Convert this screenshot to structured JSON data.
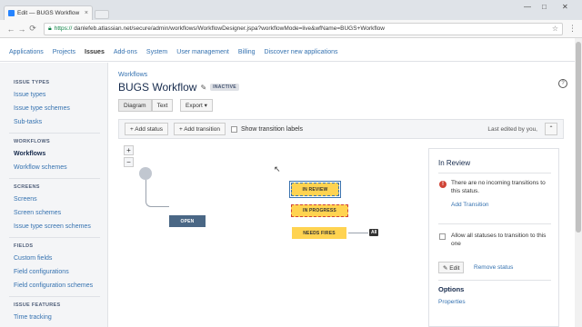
{
  "browser": {
    "tab_title": "Edit — BUGS Workflow",
    "tab_close": "×",
    "win_min": "—",
    "win_max": "□",
    "win_close": "✕",
    "secure_label": "https://",
    "url_rest": "danlefeb.atlassian.net/secure/admin/workflows/WorkflowDesigner.jspa?workflowMode=live&wfName=BUGS+Workflow",
    "back_icon": "←",
    "forward_icon": "→",
    "reload_icon": "⟳",
    "star_icon": "☆",
    "menu_icon": "⋮"
  },
  "admin_nav": [
    "Applications",
    "Projects",
    "Issues",
    "Add-ons",
    "System",
    "User management",
    "Billing",
    "Discover new applications"
  ],
  "admin_nav_active": "Issues",
  "sidebar": {
    "issue_types": {
      "heading": "ISSUE TYPES",
      "items": [
        "Issue types",
        "Issue type schemes",
        "Sub-tasks"
      ]
    },
    "workflows": {
      "heading": "WORKFLOWS",
      "items": [
        "Workflows",
        "Workflow schemes"
      ]
    },
    "screens": {
      "heading": "SCREENS",
      "items": [
        "Screens",
        "Screen schemes",
        "Issue type screen schemes"
      ]
    },
    "fields": {
      "heading": "FIELDS",
      "items": [
        "Custom fields",
        "Field configurations",
        "Field configuration schemes"
      ]
    },
    "issue_features": {
      "heading": "ISSUE FEATURES",
      "items": [
        "Time tracking"
      ]
    }
  },
  "main": {
    "breadcrumb": "Workflows",
    "title": "BUGS Workflow",
    "status_lozenge": "INACTIVE",
    "help_icon": "?",
    "view_buttons": [
      "Diagram",
      "Text"
    ],
    "export_label": "Export ▾",
    "add_status": "+ Add status",
    "add_transition": "+ Add transition",
    "show_labels": "Show transition labels",
    "last_edited": "Last edited by you,",
    "collapse_icon": "⌃"
  },
  "diagram": {
    "zoom_in": "+",
    "zoom_out": "−",
    "nodes": [
      {
        "label": "IN REVIEW",
        "color": "#ffd351",
        "selected": true
      },
      {
        "label": "IN PROGRESS",
        "color": "#ffd351",
        "selected_dashed": true
      },
      {
        "label": "OPEN",
        "color": "#4a6785"
      },
      {
        "label": "NEEDS FIRES",
        "color": "#ffd351"
      }
    ],
    "all_badge": "All"
  },
  "panel": {
    "title": "In Review",
    "no_incoming": "There are no incoming transitions to this status.",
    "add_transition_link": "Add Transition",
    "allow_all": "Allow all statuses to transition to this one",
    "edit_label": "✎ Edit",
    "remove_label": "Remove status",
    "options_heading": "Options",
    "properties_link": "Properties"
  }
}
